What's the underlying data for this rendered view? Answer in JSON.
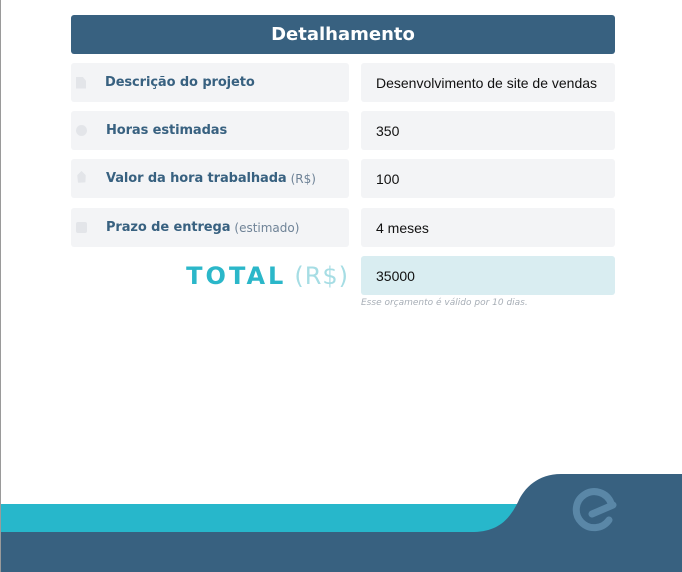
{
  "header": {
    "title": "Detalhamento"
  },
  "rows": [
    {
      "label": "Descrição do projeto",
      "sublabel": "",
      "icon": "document-icon",
      "value": "Desenvolvimento de site de vendas"
    },
    {
      "label": "Horas estimadas",
      "sublabel": "",
      "icon": "clock-icon",
      "value": "350"
    },
    {
      "label": "Valor da hora trabalhada",
      "sublabel": "(R$)",
      "icon": "tag-icon",
      "value": "100"
    },
    {
      "label": "Prazo de entrega",
      "sublabel": "(estimado)",
      "icon": "box-icon",
      "value": "4 meses"
    }
  ],
  "total": {
    "label": "TOTAL",
    "currency": "(R$)",
    "value": "35000"
  },
  "note": "Esse orçamento é válido por 10 dias.",
  "colors": {
    "primary": "#386180",
    "accent": "#2bb7c9",
    "field_bg": "#f3f4f6",
    "total_bg": "#d9edf1"
  }
}
